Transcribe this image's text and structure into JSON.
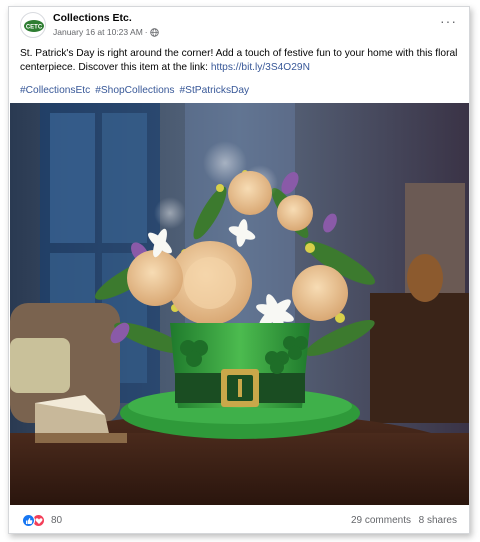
{
  "post": {
    "page_name": "Collections Etc.",
    "timestamp": "January 16 at 10:23 AM",
    "separator": "·",
    "logo_text": "CETC",
    "text": "St. Patrick's Day is right around the corner! Add a touch of festive fun to your home with this floral centerpiece. Discover this item at the link:",
    "link": "https://bit.ly/3S4O29N",
    "hashtags": [
      "#CollectionsEtc",
      "#ShopCollections",
      "#StPatricksDay"
    ],
    "reaction_count": "80",
    "comments": "29 comments",
    "shares": "8 shares"
  },
  "icons": {
    "privacy": "globe-icon",
    "more": "more-options-icon",
    "like": "like-reaction-icon",
    "love": "love-reaction-icon"
  },
  "colors": {
    "link": "#385898",
    "secondary_text": "#65676b",
    "like": "#1877f2",
    "love": "#f33e58"
  }
}
